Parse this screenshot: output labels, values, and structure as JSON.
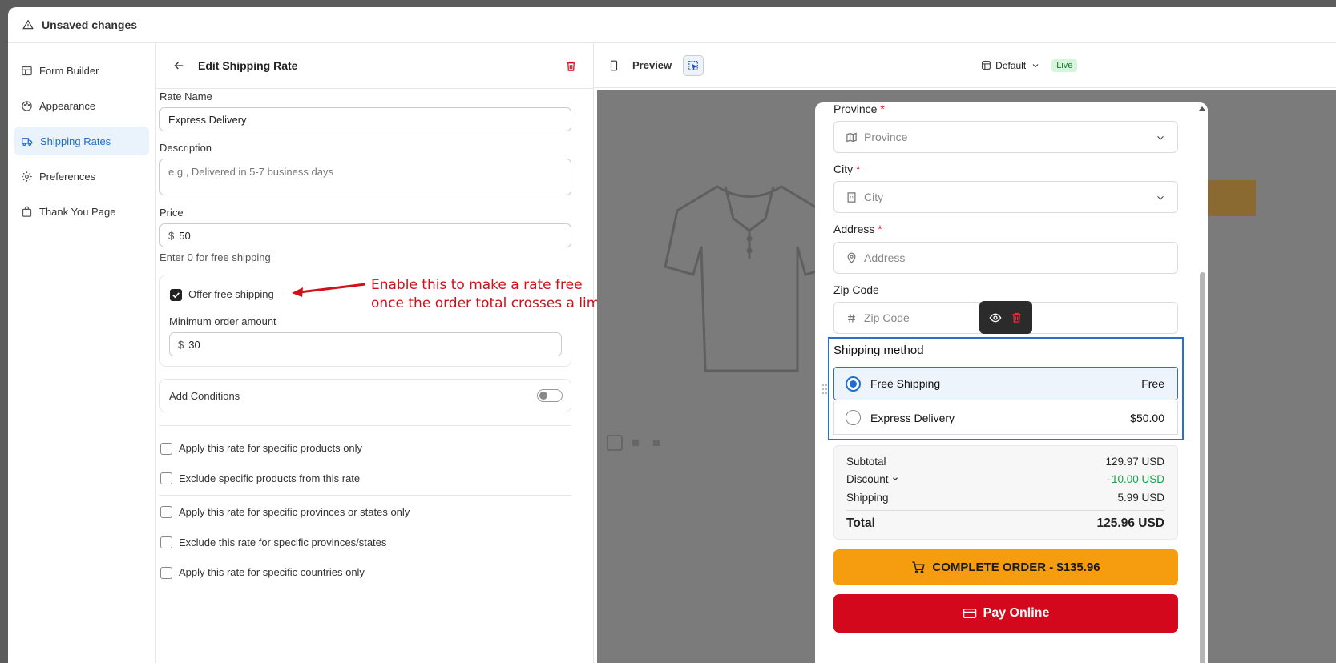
{
  "topbar": {
    "title": "Unsaved changes"
  },
  "sidebar": {
    "items": [
      {
        "label": "Form Builder",
        "icon": "form-icon"
      },
      {
        "label": "Appearance",
        "icon": "palette-icon"
      },
      {
        "label": "Shipping Rates",
        "icon": "truck-icon",
        "active": true
      },
      {
        "label": "Preferences",
        "icon": "gear-icon"
      },
      {
        "label": "Thank You Page",
        "icon": "bag-icon"
      }
    ]
  },
  "editor": {
    "title": "Edit Shipping Rate",
    "rate_name_label": "Rate Name",
    "rate_name_value": "Express Delivery",
    "description_label": "Description",
    "description_placeholder": "e.g., Delivered in 5-7 business days",
    "price_label": "Price",
    "price_currency": "$",
    "price_value": "50",
    "price_helper": "Enter 0 for free shipping",
    "free_shipping_label": "Offer free shipping",
    "free_shipping_checked": true,
    "min_order_label": "Minimum order amount",
    "min_order_currency": "$",
    "min_order_value": "30",
    "conditions_label": "Add Conditions",
    "conditions_enabled": false,
    "options": [
      "Apply this rate for specific products only",
      "Exclude specific products from this rate",
      "Apply this rate for specific provinces or states only",
      "Exclude this rate for specific provinces/states",
      "Apply this rate for specific countries only"
    ],
    "annotation_line1": "Enable this to make a rate free",
    "annotation_line2": "once the order total crosses a limit"
  },
  "preview": {
    "label": "Preview",
    "theme": "Default",
    "status": "Live",
    "form": {
      "province_label": "Province",
      "province_placeholder": "Province",
      "city_label": "City",
      "city_placeholder": "City",
      "address_label": "Address",
      "address_placeholder": "Address",
      "zip_label": "Zip Code",
      "zip_placeholder": "Zip Code",
      "required_mark": "*"
    },
    "shipping": {
      "title": "Shipping method",
      "methods": [
        {
          "name": "Free Shipping",
          "price": "Free",
          "selected": true
        },
        {
          "name": "Express Delivery",
          "price": "$50.00",
          "selected": false
        }
      ]
    },
    "summary": {
      "subtotal_label": "Subtotal",
      "subtotal_value": "129.97 USD",
      "discount_label": "Discount",
      "discount_value": "-10.00 USD",
      "shipping_label": "Shipping",
      "shipping_value": "5.99 USD",
      "total_label": "Total",
      "total_value": "125.96 USD"
    },
    "complete_button": "COMPLETE ORDER - $135.96",
    "pay_button": "Pay Online"
  },
  "colors": {
    "accent": "#1d6fd1",
    "orange": "#f59d0e",
    "red": "#d3081c",
    "discount": "#16a34a"
  }
}
